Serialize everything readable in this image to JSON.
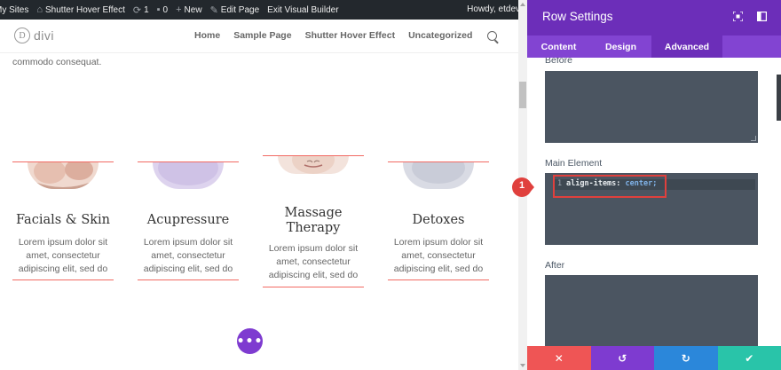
{
  "admin_bar": {
    "my_sites": "My Sites",
    "site_name": "Shutter Hover Effect",
    "updates_count": "1",
    "comments_count": "0",
    "new_label": "New",
    "edit_page": "Edit Page",
    "exit_builder": "Exit Visual Builder",
    "howdy": "Howdy, etdev"
  },
  "header": {
    "logo_letter": "D",
    "logo_text": "divi",
    "nav": [
      "Home",
      "Sample Page",
      "Shutter Hover Effect",
      "Uncategorized"
    ]
  },
  "content": {
    "intro_text": "commodo consequat.",
    "cards": [
      {
        "title": "Facials & Skin",
        "desc": [
          "Lorem ipsum dolor sit",
          "amet, consectetur",
          "adipiscing elit, sed do"
        ]
      },
      {
        "title": "Acupressure",
        "desc": [
          "Lorem ipsum dolor sit",
          "amet, consectetur",
          "adipiscing elit, sed do"
        ]
      },
      {
        "title": "Massage Therapy",
        "title_lines": [
          "Massage",
          "Therapy"
        ],
        "desc": [
          "Lorem ipsum dolor sit",
          "amet, consectetur",
          "adipiscing elit, sed do"
        ]
      },
      {
        "title": "Detoxes",
        "desc": [
          "Lorem ipsum dolor sit",
          "amet, consectetur",
          "adipiscing elit, sed do"
        ]
      }
    ],
    "more_button": "•••"
  },
  "panel": {
    "title": "Row Settings",
    "tabs": [
      "Content",
      "Design",
      "Advanced"
    ],
    "active_tab": "Advanced",
    "fields": {
      "before_label": "Before",
      "main_element_label": "Main Element",
      "main_element_line_number": "1",
      "main_element_property": "align-items: ",
      "main_element_value": "center;",
      "after_label": "After"
    },
    "callout_number": "1",
    "footer_icons": [
      "close-icon",
      "undo-icon",
      "redo-icon",
      "check-icon"
    ],
    "colors": {
      "header": "#6c2eb9",
      "tabs": "#8244d2",
      "cancel": "#ef5555",
      "undo": "#7e3bd0",
      "redo": "#2b87da",
      "save": "#29c4a9",
      "highlight": "#e0403d"
    }
  }
}
